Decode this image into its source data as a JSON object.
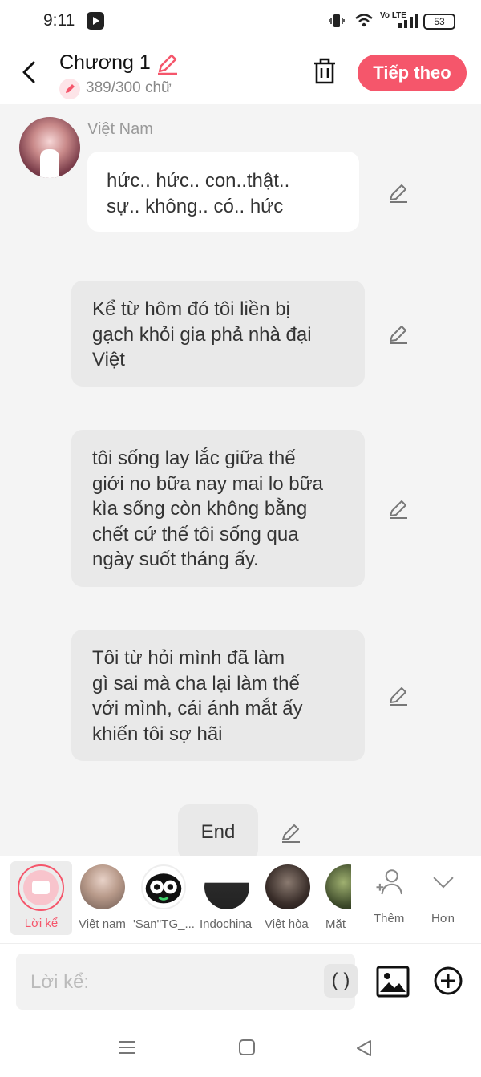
{
  "status": {
    "time": "9:11",
    "volte": "Vo LTE",
    "battery": "53"
  },
  "header": {
    "title": "Chương 1",
    "word_count": "389/300 chữ",
    "next_label": "Tiếp theo"
  },
  "messages": {
    "speaker_name": "Việt Nam",
    "m1": {
      "line1": "hức.. hức.. con..thật..",
      "line2": "sự.. không.. có.. hức"
    },
    "m2": {
      "line1": "Kể từ hôm đó tôi liền bị",
      "line2": "gạch khỏi gia phả nhà đại",
      "line3": "Việt"
    },
    "m3": {
      "line1": "tôi sống lay lắc giữa thế",
      "line2": "giới no bữa nay mai lo bữa",
      "line3": "kìa sống còn không bằng",
      "line4": "chết cứ thế tôi sống qua",
      "line5": "ngày suốt tháng ấy."
    },
    "m4": {
      "line1": "Tôi từ hỏi mình đã làm",
      "line2": "gì sai mà cha lại làm thế",
      "line3": "với mình, cái ánh mắt ấy",
      "line4": "khiến tôi sợ hãi"
    },
    "end_label": "End"
  },
  "characters": {
    "narrator": "Lời kể",
    "c1": "Việt nam",
    "c2": "'San''TG_...",
    "c3": "Indochina",
    "c4": "Việt hòa",
    "c5": "Mặt",
    "more": "Thêm",
    "less": "Hơn"
  },
  "composer": {
    "placeholder": "Lời kể:",
    "paren": "( )"
  },
  "colors": {
    "accent": "#f5566b",
    "bg": "#f4f4f4",
    "bubble_gray": "#e9e9e9"
  }
}
